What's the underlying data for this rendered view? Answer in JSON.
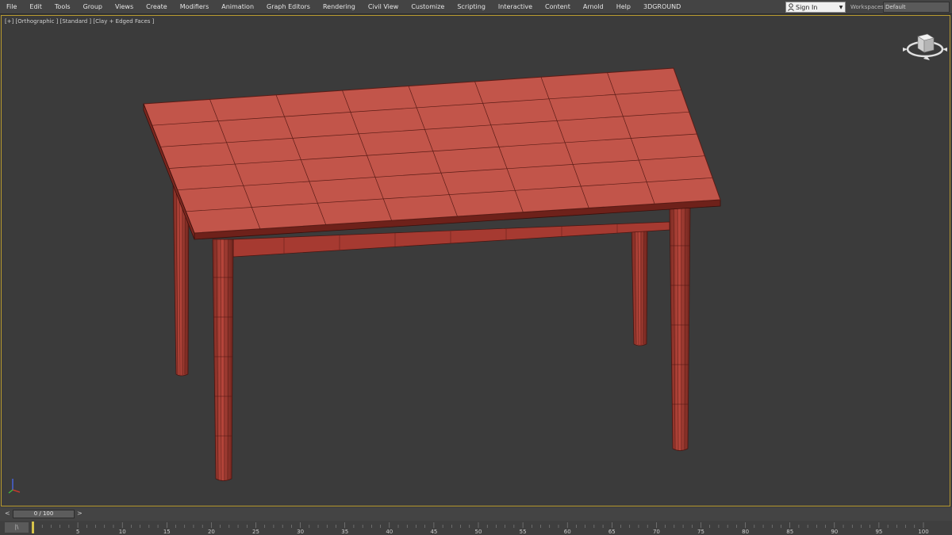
{
  "menu": [
    "File",
    "Edit",
    "Tools",
    "Group",
    "Views",
    "Create",
    "Modifiers",
    "Animation",
    "Graph Editors",
    "Rendering",
    "Civil View",
    "Customize",
    "Scripting",
    "Interactive",
    "Content",
    "Arnold",
    "Help",
    "3DGROUND"
  ],
  "account": {
    "label": "Sign In"
  },
  "workspaces": {
    "label": "Workspaces:",
    "value": "Default"
  },
  "viewport": {
    "label": "[+] [Orthographic ] [Standard ] [Clay + Edged Faces ]"
  },
  "timeline": {
    "frame_display": "0 / 100",
    "prev": "<",
    "next": ">",
    "track_icon": "|\\",
    "ticks": [
      "5",
      "10",
      "15",
      "20",
      "25",
      "30",
      "35",
      "40",
      "45",
      "50",
      "55",
      "60",
      "65",
      "70",
      "75",
      "80",
      "85",
      "90",
      "95",
      "100"
    ]
  },
  "colors": {
    "accent": "#b89a2f",
    "clay": "#c0554a",
    "wire": "#5a1c16",
    "background": "#3b3b3b"
  }
}
